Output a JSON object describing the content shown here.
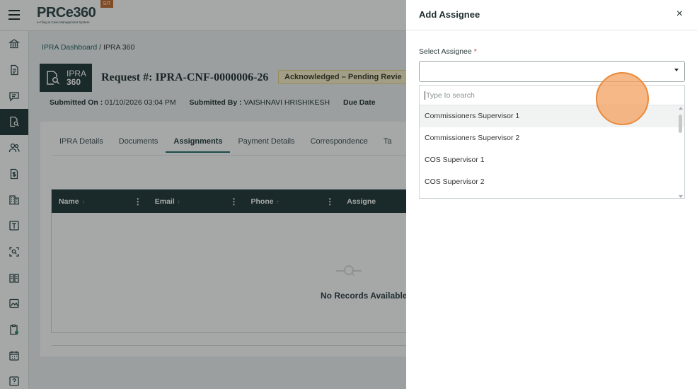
{
  "header": {
    "logo_text": "PRCe360",
    "logo_subtitle": "e-Filing & Case Management System",
    "env_badge": "SIT",
    "menu_icon": "hamburger-menu-icon"
  },
  "sidebar": {
    "items": [
      {
        "icon": "bank-icon",
        "active": false
      },
      {
        "icon": "document-icon",
        "active": false
      },
      {
        "icon": "chat-icon",
        "active": false
      },
      {
        "icon": "document-search-icon",
        "active": true
      },
      {
        "icon": "users-icon",
        "active": false
      },
      {
        "icon": "dollar-document-icon",
        "active": false
      },
      {
        "icon": "building-icon",
        "active": false
      },
      {
        "icon": "text-box-icon",
        "active": false
      },
      {
        "icon": "scan-icon",
        "active": false
      },
      {
        "icon": "book-icon",
        "active": false
      },
      {
        "icon": "image-chart-icon",
        "active": false
      },
      {
        "icon": "clipboard-clock-icon",
        "active": false
      },
      {
        "icon": "calendar-icon",
        "active": false
      },
      {
        "icon": "help-icon",
        "active": false
      }
    ]
  },
  "breadcrumb": {
    "link": "IPRA Dashboard",
    "separator": " / ",
    "current": "IPRA 360"
  },
  "request": {
    "module_line1": "IPRA",
    "module_line2": "360",
    "title": "Request #: IPRA-CNF-0000006-26",
    "status": "Acknowledged – Pending Revie",
    "submitted_on_label": "Submitted On :",
    "submitted_on_value": "01/10/2026 03:04 PM",
    "submitted_by_label": "Submitted By :",
    "submitted_by_value": "VAISHNAVI HRISHIKESH",
    "due_date_label": "Due Date"
  },
  "tabs": [
    {
      "label": "IPRA Details",
      "active": false
    },
    {
      "label": "Documents",
      "active": false
    },
    {
      "label": "Assignments",
      "active": true
    },
    {
      "label": "Payment Details",
      "active": false
    },
    {
      "label": "Correspondence",
      "active": false
    },
    {
      "label": "Ta",
      "active": false
    }
  ],
  "grid": {
    "columns": [
      "Name",
      "Email",
      "Phone",
      "Assigne"
    ],
    "empty_text": "No Records Available."
  },
  "panel": {
    "title": "Add Assignee",
    "close_icon": "close-icon",
    "field_label": "Select Assignee",
    "required_mark": "*",
    "selected_value": "",
    "search_placeholder": "Type to search",
    "options": [
      "Commissioners Supervisor 1",
      "Commissioners Supervisor 2",
      "COS Supervisor 1",
      "COS Supervisor 2"
    ]
  },
  "colors": {
    "primary_dark": "#1e3333",
    "accent_tab": "#1e6a6a",
    "status_badge_bg": "#fbefc9",
    "click_marker": "#f4a05f"
  }
}
